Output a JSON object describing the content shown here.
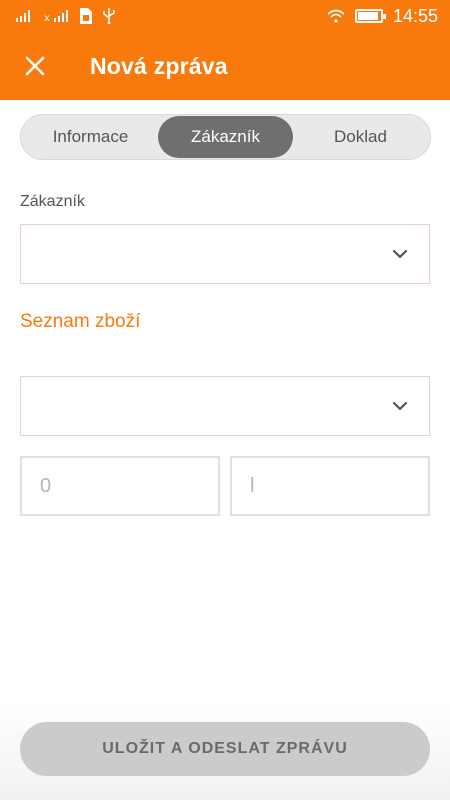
{
  "status_bar": {
    "time": "14:55",
    "left_icons": [
      "signal-icon",
      "signal-x-icon",
      "sim-icon",
      "usb-icon"
    ],
    "right_icons": [
      "wifi-icon",
      "battery-icon"
    ],
    "battery_level": 0.9
  },
  "header": {
    "title": "Nová zpráva",
    "close_icon": "close-icon",
    "background": "#f97a0c"
  },
  "tabs": [
    {
      "label": "Informace",
      "active": false
    },
    {
      "label": "Zákazník",
      "active": true
    },
    {
      "label": "Doklad",
      "active": false
    }
  ],
  "form": {
    "customer_label": "Zákazník",
    "customer_select_value": "",
    "goods_section_title": "Seznam zboží",
    "goods_select_value": "",
    "quantity_placeholder": "0",
    "unit_placeholder": "l"
  },
  "footer": {
    "save_label": "ULOŽIT A ODESLAT ZPRÁVU"
  },
  "colors": {
    "accent": "#f97a0c",
    "active_tab": "#6f6f6f",
    "disabled_button": "#cbcbcb"
  }
}
